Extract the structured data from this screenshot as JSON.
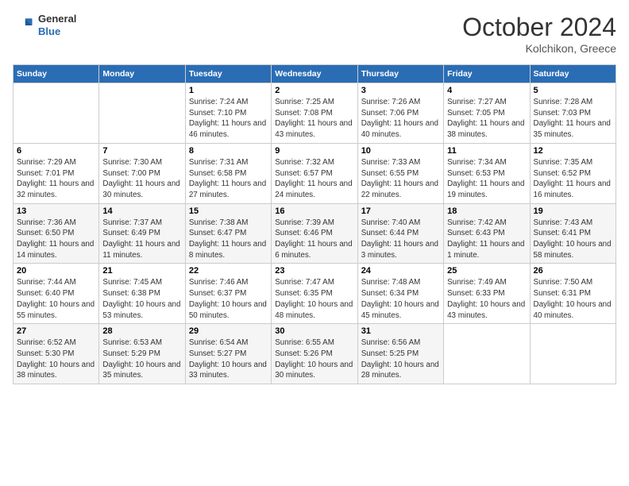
{
  "header": {
    "logo": {
      "general": "General",
      "blue": "Blue"
    },
    "title": "October 2024",
    "location": "Kolchikon, Greece"
  },
  "calendar": {
    "days_of_week": [
      "Sunday",
      "Monday",
      "Tuesday",
      "Wednesday",
      "Thursday",
      "Friday",
      "Saturday"
    ],
    "weeks": [
      [
        {
          "day": "",
          "info": ""
        },
        {
          "day": "",
          "info": ""
        },
        {
          "day": "1",
          "info": "Sunrise: 7:24 AM\nSunset: 7:10 PM\nDaylight: 11 hours and 46 minutes."
        },
        {
          "day": "2",
          "info": "Sunrise: 7:25 AM\nSunset: 7:08 PM\nDaylight: 11 hours and 43 minutes."
        },
        {
          "day": "3",
          "info": "Sunrise: 7:26 AM\nSunset: 7:06 PM\nDaylight: 11 hours and 40 minutes."
        },
        {
          "day": "4",
          "info": "Sunrise: 7:27 AM\nSunset: 7:05 PM\nDaylight: 11 hours and 38 minutes."
        },
        {
          "day": "5",
          "info": "Sunrise: 7:28 AM\nSunset: 7:03 PM\nDaylight: 11 hours and 35 minutes."
        }
      ],
      [
        {
          "day": "6",
          "info": "Sunrise: 7:29 AM\nSunset: 7:01 PM\nDaylight: 11 hours and 32 minutes."
        },
        {
          "day": "7",
          "info": "Sunrise: 7:30 AM\nSunset: 7:00 PM\nDaylight: 11 hours and 30 minutes."
        },
        {
          "day": "8",
          "info": "Sunrise: 7:31 AM\nSunset: 6:58 PM\nDaylight: 11 hours and 27 minutes."
        },
        {
          "day": "9",
          "info": "Sunrise: 7:32 AM\nSunset: 6:57 PM\nDaylight: 11 hours and 24 minutes."
        },
        {
          "day": "10",
          "info": "Sunrise: 7:33 AM\nSunset: 6:55 PM\nDaylight: 11 hours and 22 minutes."
        },
        {
          "day": "11",
          "info": "Sunrise: 7:34 AM\nSunset: 6:53 PM\nDaylight: 11 hours and 19 minutes."
        },
        {
          "day": "12",
          "info": "Sunrise: 7:35 AM\nSunset: 6:52 PM\nDaylight: 11 hours and 16 minutes."
        }
      ],
      [
        {
          "day": "13",
          "info": "Sunrise: 7:36 AM\nSunset: 6:50 PM\nDaylight: 11 hours and 14 minutes."
        },
        {
          "day": "14",
          "info": "Sunrise: 7:37 AM\nSunset: 6:49 PM\nDaylight: 11 hours and 11 minutes."
        },
        {
          "day": "15",
          "info": "Sunrise: 7:38 AM\nSunset: 6:47 PM\nDaylight: 11 hours and 8 minutes."
        },
        {
          "day": "16",
          "info": "Sunrise: 7:39 AM\nSunset: 6:46 PM\nDaylight: 11 hours and 6 minutes."
        },
        {
          "day": "17",
          "info": "Sunrise: 7:40 AM\nSunset: 6:44 PM\nDaylight: 11 hours and 3 minutes."
        },
        {
          "day": "18",
          "info": "Sunrise: 7:42 AM\nSunset: 6:43 PM\nDaylight: 11 hours and 1 minute."
        },
        {
          "day": "19",
          "info": "Sunrise: 7:43 AM\nSunset: 6:41 PM\nDaylight: 10 hours and 58 minutes."
        }
      ],
      [
        {
          "day": "20",
          "info": "Sunrise: 7:44 AM\nSunset: 6:40 PM\nDaylight: 10 hours and 55 minutes."
        },
        {
          "day": "21",
          "info": "Sunrise: 7:45 AM\nSunset: 6:38 PM\nDaylight: 10 hours and 53 minutes."
        },
        {
          "day": "22",
          "info": "Sunrise: 7:46 AM\nSunset: 6:37 PM\nDaylight: 10 hours and 50 minutes."
        },
        {
          "day": "23",
          "info": "Sunrise: 7:47 AM\nSunset: 6:35 PM\nDaylight: 10 hours and 48 minutes."
        },
        {
          "day": "24",
          "info": "Sunrise: 7:48 AM\nSunset: 6:34 PM\nDaylight: 10 hours and 45 minutes."
        },
        {
          "day": "25",
          "info": "Sunrise: 7:49 AM\nSunset: 6:33 PM\nDaylight: 10 hours and 43 minutes."
        },
        {
          "day": "26",
          "info": "Sunrise: 7:50 AM\nSunset: 6:31 PM\nDaylight: 10 hours and 40 minutes."
        }
      ],
      [
        {
          "day": "27",
          "info": "Sunrise: 6:52 AM\nSunset: 5:30 PM\nDaylight: 10 hours and 38 minutes."
        },
        {
          "day": "28",
          "info": "Sunrise: 6:53 AM\nSunset: 5:29 PM\nDaylight: 10 hours and 35 minutes."
        },
        {
          "day": "29",
          "info": "Sunrise: 6:54 AM\nSunset: 5:27 PM\nDaylight: 10 hours and 33 minutes."
        },
        {
          "day": "30",
          "info": "Sunrise: 6:55 AM\nSunset: 5:26 PM\nDaylight: 10 hours and 30 minutes."
        },
        {
          "day": "31",
          "info": "Sunrise: 6:56 AM\nSunset: 5:25 PM\nDaylight: 10 hours and 28 minutes."
        },
        {
          "day": "",
          "info": ""
        },
        {
          "day": "",
          "info": ""
        }
      ]
    ]
  }
}
